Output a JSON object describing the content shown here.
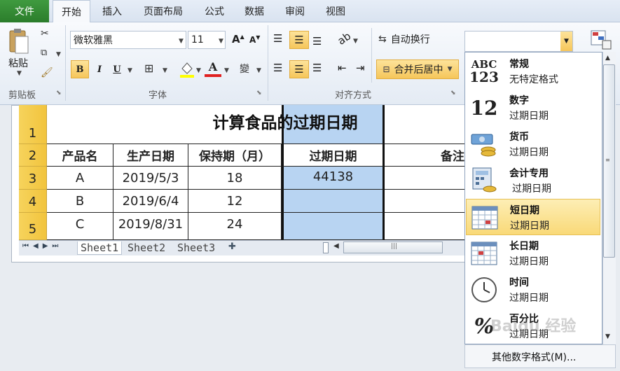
{
  "tabs": {
    "file": "文件",
    "items": [
      "开始",
      "插入",
      "页面布局",
      "公式",
      "数据",
      "审阅",
      "视图"
    ]
  },
  "clipboard": {
    "paste_label": "粘贴",
    "group_label": "剪贴板"
  },
  "font": {
    "name": "微软雅黑",
    "size": "11",
    "bold": "B",
    "italic": "I",
    "underline": "U",
    "group_label": "字体",
    "grow": "A",
    "shrink": "A",
    "color_a": "A",
    "phonetic": "變"
  },
  "alignment": {
    "wrap_text": "自动换行",
    "merge_center": "合并后居中",
    "group_label": "对齐方式"
  },
  "number_format": {
    "value": ""
  },
  "sheet": {
    "title": "计算食品的过期日期",
    "row_numbers": [
      "1",
      "2",
      "3",
      "4",
      "5"
    ],
    "headers": [
      "产品名",
      "生产日期",
      "保持期（月）",
      "过期日期",
      "备注"
    ],
    "rows": [
      [
        "A",
        "2019/5/3",
        "18",
        "44138",
        ""
      ],
      [
        "B",
        "2019/6/4",
        "12",
        "",
        ""
      ],
      [
        "C",
        "2019/8/31",
        "24",
        "",
        ""
      ]
    ],
    "tabs": [
      "Sheet1",
      "Sheet2",
      "Sheet3"
    ]
  },
  "dropdown": {
    "items": [
      {
        "title": "常规",
        "sub": "无特定格式",
        "icon": "abc-123-icon"
      },
      {
        "title": "数字",
        "sub": "过期日期",
        "icon": "number-12-icon"
      },
      {
        "title": "货币",
        "sub": "过期日期",
        "icon": "currency-icon"
      },
      {
        "title": "会计专用",
        "sub": "过期日期",
        "icon": "accounting-icon"
      },
      {
        "title": "短日期",
        "sub": "过期日期",
        "icon": "calendar-short-icon"
      },
      {
        "title": "长日期",
        "sub": "过期日期",
        "icon": "calendar-long-icon"
      },
      {
        "title": "时间",
        "sub": "过期日期",
        "icon": "clock-icon"
      },
      {
        "title": "百分比",
        "sub": "过期日期",
        "icon": "percent-icon"
      }
    ],
    "more": "其他数字格式(M)..."
  },
  "watermark": "Baidu 经验",
  "colors": {
    "file_tab": "#2b7d2b",
    "highlight": "#f9d978",
    "row_header": "#f2c43d",
    "selected_col": "#b8d4f2"
  }
}
